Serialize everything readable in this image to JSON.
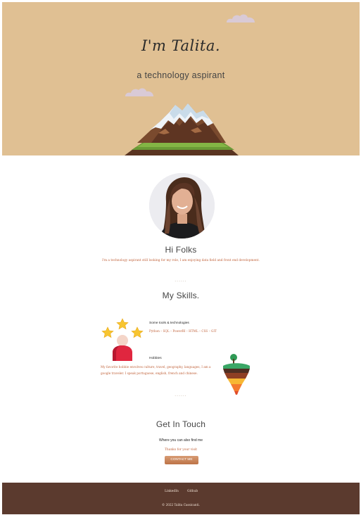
{
  "hero": {
    "title": "I'm Talita.",
    "subtitle": "a technology aspirant"
  },
  "about": {
    "title": "Hi Folks",
    "text": "I'm a technology aspirant still looking for my role, I am enjoying data field and front end development.",
    "divider": "......"
  },
  "skills": {
    "title": "My Skills.",
    "tools_heading": "Some tools & technologies",
    "tools_list": "Python – SQL – PowerBI – HTML – CSS – GIT",
    "hobbies_heading": "Hobbies",
    "hobbies_text_line1": "My favorite hobbie envolves culture, travel, geography, languages, I am a",
    "hobbies_text_line2": "google traveler. I speak portuguese, english, french and chinese.",
    "divider": "......"
  },
  "contact": {
    "title": "Get In Touch",
    "subtitle": "Where you can also find me",
    "thanks": "Thanks for your visit",
    "button_label": "CONTACT ME"
  },
  "footer": {
    "links": [
      "LinkedIn",
      "Github"
    ],
    "copyright": "© 2022 Talita Cassicanti."
  },
  "colors": {
    "hero_bg": "#e0c093",
    "accent_text": "#c0623a",
    "button": "#c98158",
    "footer_bg": "#5b3a2e",
    "cloud": "#d9cad6"
  },
  "icons": [
    "cloud-icon",
    "mountain-illustration",
    "profile-photo",
    "stars-person-icon",
    "plant-cone-icon"
  ]
}
